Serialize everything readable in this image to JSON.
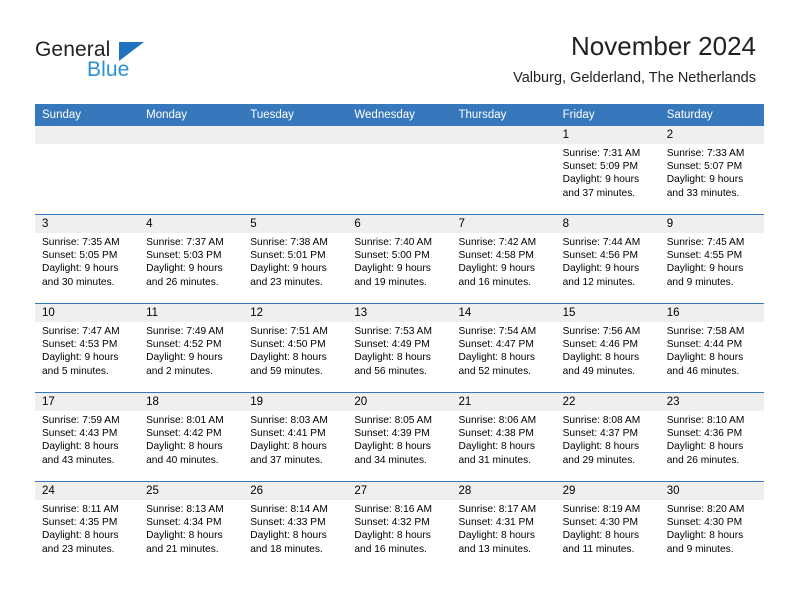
{
  "brand": {
    "name_part1": "General",
    "name_part2": "Blue",
    "flag_icon": "triangle-flag-icon",
    "accent_color": "#1f72bd",
    "blue_text_color": "#2d8fd5"
  },
  "header": {
    "title": "November 2024",
    "subtitle": "Valburg, Gelderland, The Netherlands"
  },
  "calendar": {
    "header_bg": "#3778bc",
    "header_text_color": "#ffffff",
    "day_band_bg": "#efefef",
    "weekdays": [
      "Sunday",
      "Monday",
      "Tuesday",
      "Wednesday",
      "Thursday",
      "Friday",
      "Saturday"
    ],
    "weeks": [
      [
        {
          "day": "",
          "empty": true
        },
        {
          "day": "",
          "empty": true
        },
        {
          "day": "",
          "empty": true
        },
        {
          "day": "",
          "empty": true
        },
        {
          "day": "",
          "empty": true
        },
        {
          "day": "1",
          "sunrise": "Sunrise: 7:31 AM",
          "sunset": "Sunset: 5:09 PM",
          "daylight": "Daylight: 9 hours and 37 minutes."
        },
        {
          "day": "2",
          "sunrise": "Sunrise: 7:33 AM",
          "sunset": "Sunset: 5:07 PM",
          "daylight": "Daylight: 9 hours and 33 minutes."
        }
      ],
      [
        {
          "day": "3",
          "sunrise": "Sunrise: 7:35 AM",
          "sunset": "Sunset: 5:05 PM",
          "daylight": "Daylight: 9 hours and 30 minutes."
        },
        {
          "day": "4",
          "sunrise": "Sunrise: 7:37 AM",
          "sunset": "Sunset: 5:03 PM",
          "daylight": "Daylight: 9 hours and 26 minutes."
        },
        {
          "day": "5",
          "sunrise": "Sunrise: 7:38 AM",
          "sunset": "Sunset: 5:01 PM",
          "daylight": "Daylight: 9 hours and 23 minutes."
        },
        {
          "day": "6",
          "sunrise": "Sunrise: 7:40 AM",
          "sunset": "Sunset: 5:00 PM",
          "daylight": "Daylight: 9 hours and 19 minutes."
        },
        {
          "day": "7",
          "sunrise": "Sunrise: 7:42 AM",
          "sunset": "Sunset: 4:58 PM",
          "daylight": "Daylight: 9 hours and 16 minutes."
        },
        {
          "day": "8",
          "sunrise": "Sunrise: 7:44 AM",
          "sunset": "Sunset: 4:56 PM",
          "daylight": "Daylight: 9 hours and 12 minutes."
        },
        {
          "day": "9",
          "sunrise": "Sunrise: 7:45 AM",
          "sunset": "Sunset: 4:55 PM",
          "daylight": "Daylight: 9 hours and 9 minutes."
        }
      ],
      [
        {
          "day": "10",
          "sunrise": "Sunrise: 7:47 AM",
          "sunset": "Sunset: 4:53 PM",
          "daylight": "Daylight: 9 hours and 5 minutes."
        },
        {
          "day": "11",
          "sunrise": "Sunrise: 7:49 AM",
          "sunset": "Sunset: 4:52 PM",
          "daylight": "Daylight: 9 hours and 2 minutes."
        },
        {
          "day": "12",
          "sunrise": "Sunrise: 7:51 AM",
          "sunset": "Sunset: 4:50 PM",
          "daylight": "Daylight: 8 hours and 59 minutes."
        },
        {
          "day": "13",
          "sunrise": "Sunrise: 7:53 AM",
          "sunset": "Sunset: 4:49 PM",
          "daylight": "Daylight: 8 hours and 56 minutes."
        },
        {
          "day": "14",
          "sunrise": "Sunrise: 7:54 AM",
          "sunset": "Sunset: 4:47 PM",
          "daylight": "Daylight: 8 hours and 52 minutes."
        },
        {
          "day": "15",
          "sunrise": "Sunrise: 7:56 AM",
          "sunset": "Sunset: 4:46 PM",
          "daylight": "Daylight: 8 hours and 49 minutes."
        },
        {
          "day": "16",
          "sunrise": "Sunrise: 7:58 AM",
          "sunset": "Sunset: 4:44 PM",
          "daylight": "Daylight: 8 hours and 46 minutes."
        }
      ],
      [
        {
          "day": "17",
          "sunrise": "Sunrise: 7:59 AM",
          "sunset": "Sunset: 4:43 PM",
          "daylight": "Daylight: 8 hours and 43 minutes."
        },
        {
          "day": "18",
          "sunrise": "Sunrise: 8:01 AM",
          "sunset": "Sunset: 4:42 PM",
          "daylight": "Daylight: 8 hours and 40 minutes."
        },
        {
          "day": "19",
          "sunrise": "Sunrise: 8:03 AM",
          "sunset": "Sunset: 4:41 PM",
          "daylight": "Daylight: 8 hours and 37 minutes."
        },
        {
          "day": "20",
          "sunrise": "Sunrise: 8:05 AM",
          "sunset": "Sunset: 4:39 PM",
          "daylight": "Daylight: 8 hours and 34 minutes."
        },
        {
          "day": "21",
          "sunrise": "Sunrise: 8:06 AM",
          "sunset": "Sunset: 4:38 PM",
          "daylight": "Daylight: 8 hours and 31 minutes."
        },
        {
          "day": "22",
          "sunrise": "Sunrise: 8:08 AM",
          "sunset": "Sunset: 4:37 PM",
          "daylight": "Daylight: 8 hours and 29 minutes."
        },
        {
          "day": "23",
          "sunrise": "Sunrise: 8:10 AM",
          "sunset": "Sunset: 4:36 PM",
          "daylight": "Daylight: 8 hours and 26 minutes."
        }
      ],
      [
        {
          "day": "24",
          "sunrise": "Sunrise: 8:11 AM",
          "sunset": "Sunset: 4:35 PM",
          "daylight": "Daylight: 8 hours and 23 minutes."
        },
        {
          "day": "25",
          "sunrise": "Sunrise: 8:13 AM",
          "sunset": "Sunset: 4:34 PM",
          "daylight": "Daylight: 8 hours and 21 minutes."
        },
        {
          "day": "26",
          "sunrise": "Sunrise: 8:14 AM",
          "sunset": "Sunset: 4:33 PM",
          "daylight": "Daylight: 8 hours and 18 minutes."
        },
        {
          "day": "27",
          "sunrise": "Sunrise: 8:16 AM",
          "sunset": "Sunset: 4:32 PM",
          "daylight": "Daylight: 8 hours and 16 minutes."
        },
        {
          "day": "28",
          "sunrise": "Sunrise: 8:17 AM",
          "sunset": "Sunset: 4:31 PM",
          "daylight": "Daylight: 8 hours and 13 minutes."
        },
        {
          "day": "29",
          "sunrise": "Sunrise: 8:19 AM",
          "sunset": "Sunset: 4:30 PM",
          "daylight": "Daylight: 8 hours and 11 minutes."
        },
        {
          "day": "30",
          "sunrise": "Sunrise: 8:20 AM",
          "sunset": "Sunset: 4:30 PM",
          "daylight": "Daylight: 8 hours and 9 minutes."
        }
      ]
    ]
  }
}
